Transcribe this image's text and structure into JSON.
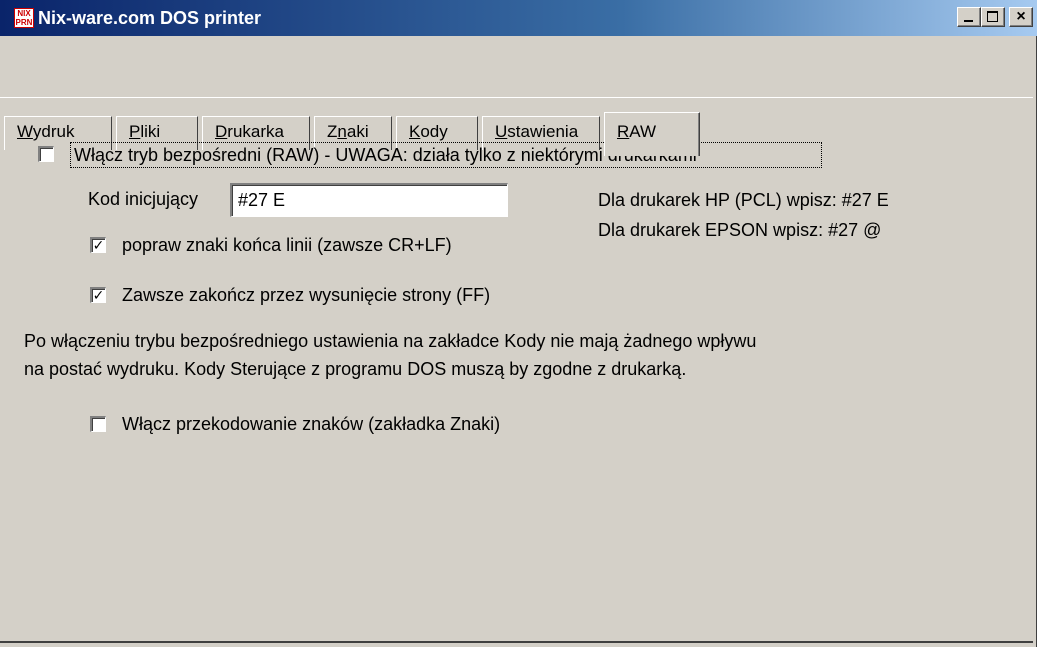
{
  "window": {
    "title": "Nix-ware.com DOS printer",
    "icon_text_top": "NIX",
    "icon_text_bottom": "PRN",
    "controls": {
      "minimize": "_",
      "maximize": "□",
      "close": "×"
    }
  },
  "tabs": [
    {
      "label": "Wydruk",
      "accel": "W",
      "active": false
    },
    {
      "label": "Pliki",
      "accel": "P",
      "active": false
    },
    {
      "label": "Drukarka",
      "accel": "D",
      "active": false
    },
    {
      "label": "Znaki",
      "accel": "n",
      "active": false
    },
    {
      "label": "Kody",
      "accel": "K",
      "active": false
    },
    {
      "label": "Ustawienia",
      "accel": "U",
      "active": false
    },
    {
      "label": "RAW",
      "accel": "R",
      "active": true
    }
  ],
  "raw": {
    "enable_raw": {
      "label": "Włącz tryb bezpośredni (RAW) - UWAGA: działa tylko z niektórymi drukarkami",
      "checked": false
    },
    "init_code": {
      "label": "Kod inicjujący",
      "value": "#27 E"
    },
    "hint_hp": "Dla drukarek HP (PCL) wpisz: #27 E",
    "hint_epson": "Dla drukarek EPSON wpisz: #27 @",
    "fix_line_endings": {
      "label": "popraw znaki końca linii (zawsze CR+LF)",
      "checked": true
    },
    "form_feed": {
      "label": "Zawsze zakończ przez wysunięcie strony (FF)",
      "checked": true
    },
    "note_line1": "Po włączeniu trybu bezpośredniego ustawienia na zakładce Kody nie mają żadnego wpływu",
    "note_line2": "na postać wydruku. Kody Sterujące z programu DOS muszą by zgodne z drukarką.",
    "recode_chars": {
      "label": "Włącz przekodowanie znaków (zakładka Znaki)",
      "checked": false
    }
  },
  "colors": {
    "face": "#d4d0c8",
    "title_start": "#0a246a",
    "title_end": "#a6caf0"
  }
}
